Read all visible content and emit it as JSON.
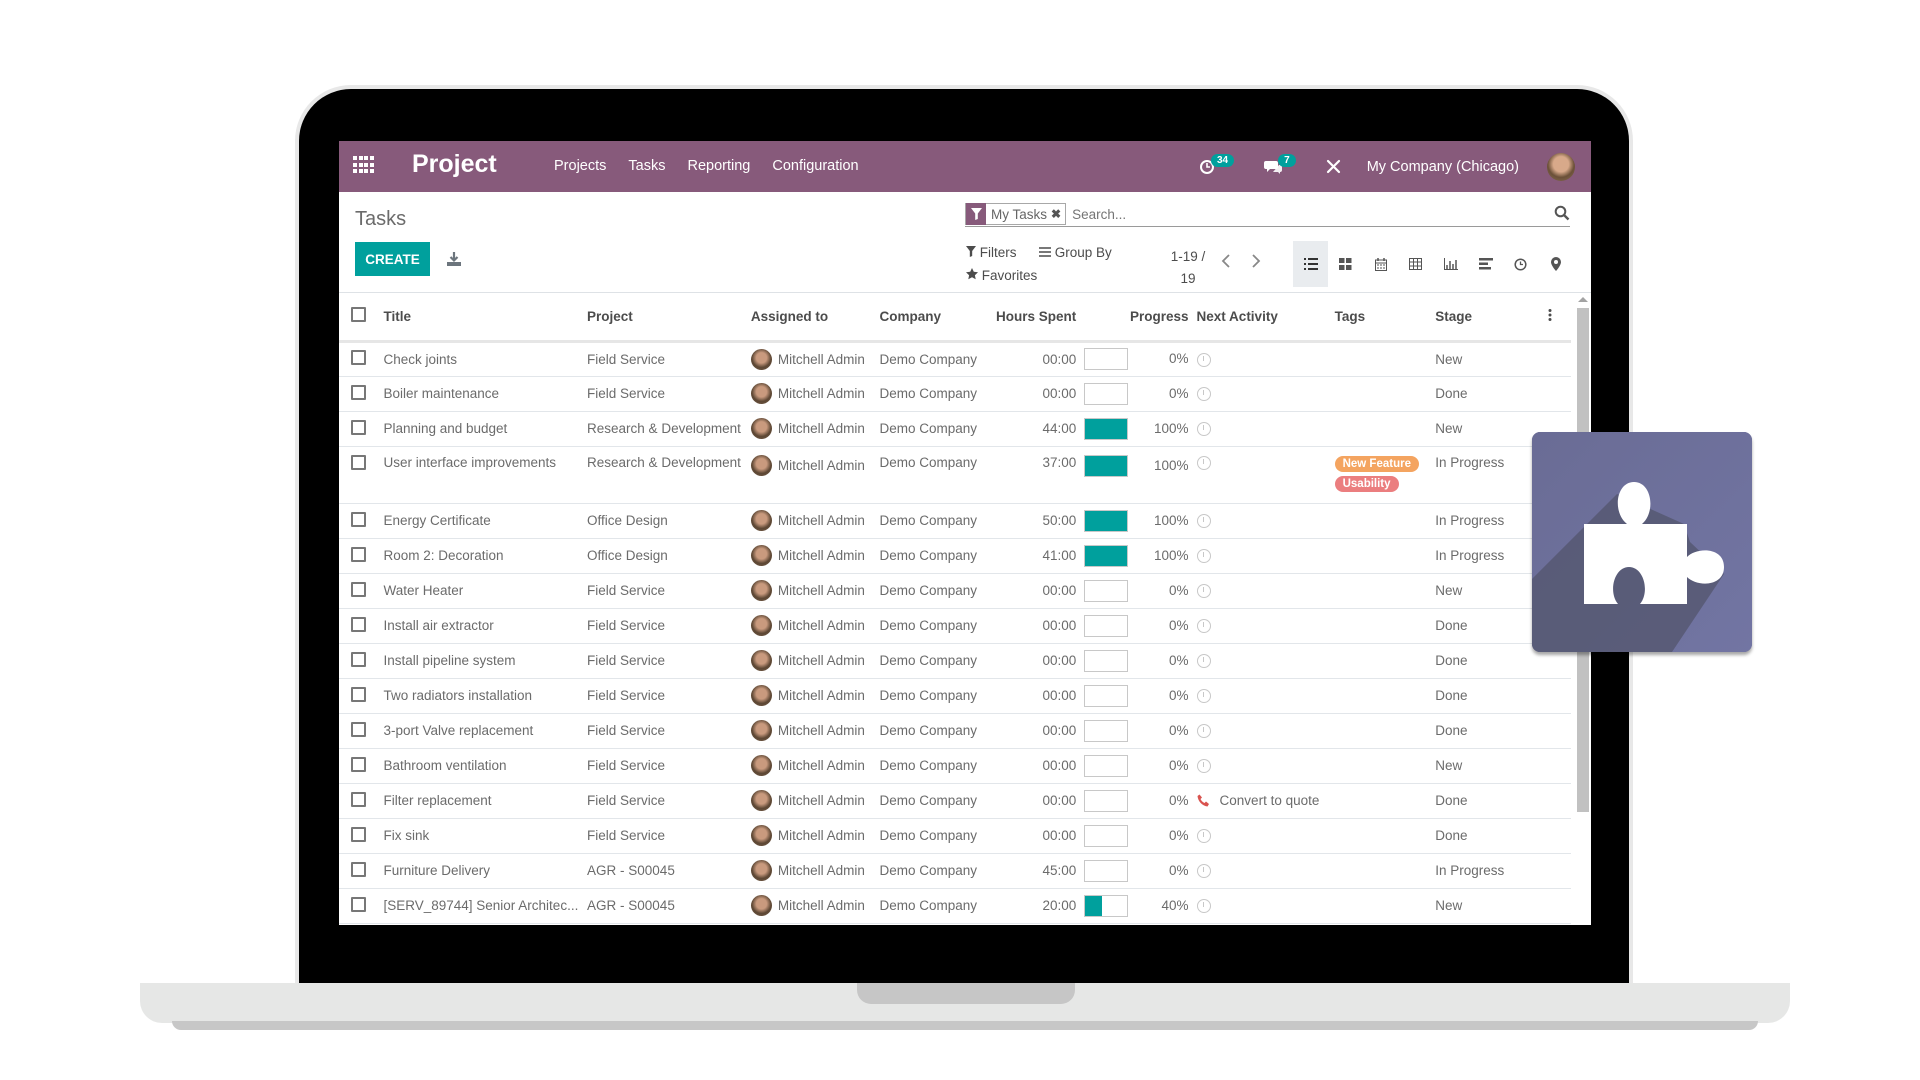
{
  "navbar": {
    "app_name": "Project",
    "menu": [
      "Projects",
      "Tasks",
      "Reporting",
      "Configuration"
    ],
    "activity_count": "34",
    "messages_count": "7",
    "company": "My Company (Chicago)",
    "brand_color": "#875A7B"
  },
  "control_panel": {
    "breadcrumb": "Tasks",
    "create_label": "CREATE",
    "search": {
      "facet_label": "My Tasks",
      "placeholder": "Search..."
    },
    "filters_label": "Filters",
    "group_by_label": "Group By",
    "favorites_label": "Favorites",
    "pager": {
      "range": "1-19 /",
      "total": "19"
    },
    "views": [
      "list",
      "kanban",
      "calendar",
      "pivot",
      "graph",
      "gantt",
      "activity",
      "map"
    ],
    "active_view": "list"
  },
  "list": {
    "columns": [
      "Title",
      "Project",
      "Assigned to",
      "Company",
      "Hours Spent",
      "Progress",
      "Next Activity",
      "Tags",
      "Stage"
    ],
    "rows": [
      {
        "title": "Check joints",
        "project": "Field Service",
        "assigned": "Mitchell Admin",
        "company": "Demo Company",
        "hours": "00:00",
        "progress": 0,
        "progress_label": "0%",
        "activity": "",
        "tags": [],
        "stage": "New"
      },
      {
        "title": "Boiler maintenance",
        "project": "Field Service",
        "assigned": "Mitchell Admin",
        "company": "Demo Company",
        "hours": "00:00",
        "progress": 0,
        "progress_label": "0%",
        "activity": "",
        "tags": [],
        "stage": "Done"
      },
      {
        "title": "Planning and budget",
        "project": "Research & Development",
        "assigned": "Mitchell Admin",
        "company": "Demo Company",
        "hours": "44:00",
        "progress": 100,
        "progress_label": "100%",
        "activity": "",
        "tags": [],
        "stage": "New"
      },
      {
        "title": "User interface improvements",
        "project": "Research & Development",
        "assigned": "Mitchell Admin",
        "company": "Demo Company",
        "hours": "37:00",
        "progress": 100,
        "progress_label": "100%",
        "activity": "",
        "tags": [
          {
            "label": "New Feature",
            "color": "#F4A460"
          },
          {
            "label": "Usability",
            "color": "#EB7E7F"
          }
        ],
        "stage": "In Progress"
      },
      {
        "title": "Energy Certificate",
        "project": "Office Design",
        "assigned": "Mitchell Admin",
        "company": "Demo Company",
        "hours": "50:00",
        "progress": 100,
        "progress_label": "100%",
        "activity": "",
        "tags": [],
        "stage": "In Progress"
      },
      {
        "title": "Room 2: Decoration",
        "project": "Office Design",
        "assigned": "Mitchell Admin",
        "company": "Demo Company",
        "hours": "41:00",
        "progress": 100,
        "progress_label": "100%",
        "activity": "",
        "tags": [],
        "stage": "In Progress"
      },
      {
        "title": "Water Heater",
        "project": "Field Service",
        "assigned": "Mitchell Admin",
        "company": "Demo Company",
        "hours": "00:00",
        "progress": 0,
        "progress_label": "0%",
        "activity": "",
        "tags": [],
        "stage": "New"
      },
      {
        "title": "Install air extractor",
        "project": "Field Service",
        "assigned": "Mitchell Admin",
        "company": "Demo Company",
        "hours": "00:00",
        "progress": 0,
        "progress_label": "0%",
        "activity": "",
        "tags": [],
        "stage": "Done"
      },
      {
        "title": "Install pipeline system",
        "project": "Field Service",
        "assigned": "Mitchell Admin",
        "company": "Demo Company",
        "hours": "00:00",
        "progress": 0,
        "progress_label": "0%",
        "activity": "",
        "tags": [],
        "stage": "Done"
      },
      {
        "title": "Two radiators installation",
        "project": "Field Service",
        "assigned": "Mitchell Admin",
        "company": "Demo Company",
        "hours": "00:00",
        "progress": 0,
        "progress_label": "0%",
        "activity": "",
        "tags": [],
        "stage": "Done"
      },
      {
        "title": "3-port Valve replacement",
        "project": "Field Service",
        "assigned": "Mitchell Admin",
        "company": "Demo Company",
        "hours": "00:00",
        "progress": 0,
        "progress_label": "0%",
        "activity": "",
        "tags": [],
        "stage": "Done"
      },
      {
        "title": "Bathroom ventilation",
        "project": "Field Service",
        "assigned": "Mitchell Admin",
        "company": "Demo Company",
        "hours": "00:00",
        "progress": 0,
        "progress_label": "0%",
        "activity": "",
        "tags": [],
        "stage": "New"
      },
      {
        "title": "Filter replacement",
        "project": "Field Service",
        "assigned": "Mitchell Admin",
        "company": "Demo Company",
        "hours": "00:00",
        "progress": 0,
        "progress_label": "0%",
        "activity": "Convert to quote",
        "activity_icon": "phone-icon",
        "tags": [],
        "stage": "Done"
      },
      {
        "title": "Fix sink",
        "project": "Field Service",
        "assigned": "Mitchell Admin",
        "company": "Demo Company",
        "hours": "00:00",
        "progress": 0,
        "progress_label": "0%",
        "activity": "",
        "tags": [],
        "stage": "Done"
      },
      {
        "title": "Furniture Delivery",
        "project": "AGR - S00045",
        "assigned": "Mitchell Admin",
        "company": "Demo Company",
        "hours": "45:00",
        "progress": 0,
        "progress_label": "0%",
        "activity": "",
        "tags": [],
        "stage": "In Progress"
      },
      {
        "title": "[SERV_89744] Senior Architec...",
        "project": "AGR - S00045",
        "assigned": "Mitchell Admin",
        "company": "Demo Company",
        "hours": "20:00",
        "progress": 40,
        "progress_label": "40%",
        "activity": "",
        "tags": [],
        "stage": "New"
      }
    ],
    "progress_color": "#00A09D"
  },
  "overlay": {
    "icon": "puzzle-icon",
    "color": "#6c6f99"
  }
}
